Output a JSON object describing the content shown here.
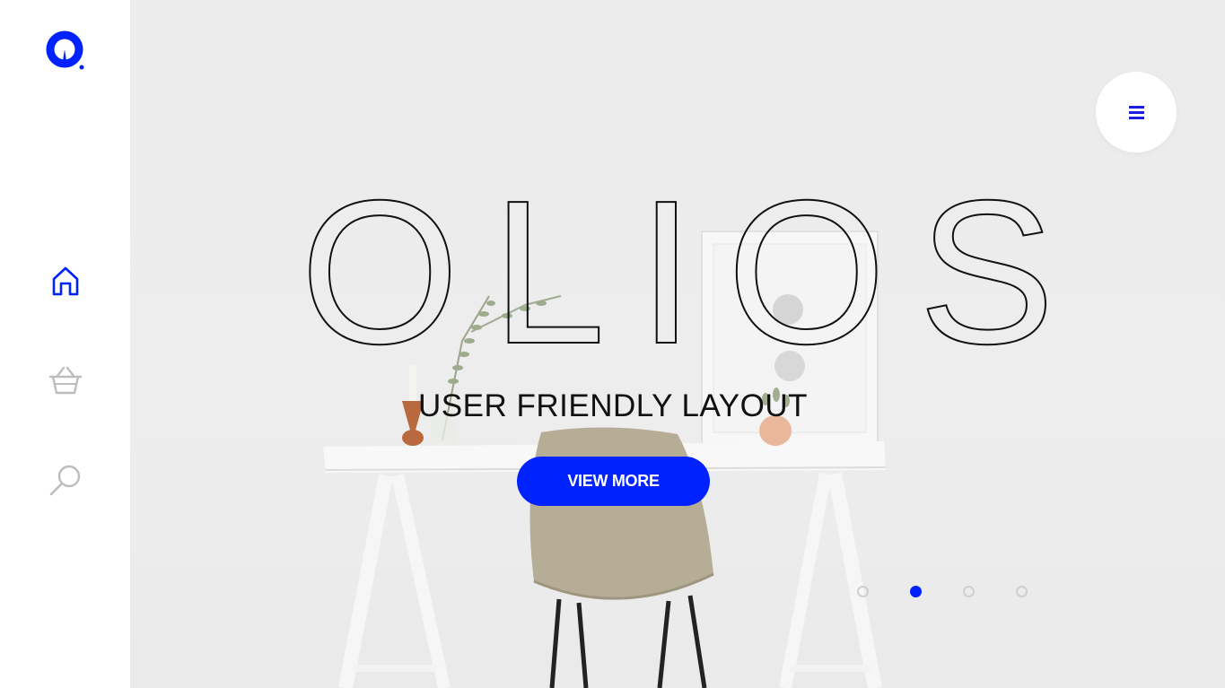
{
  "sidebar": {
    "logo_icon": "olios-logo-icon",
    "items": [
      {
        "icon": "home-icon",
        "active": true
      },
      {
        "icon": "basket-icon",
        "active": false
      },
      {
        "icon": "search-icon",
        "active": false
      }
    ]
  },
  "hero": {
    "title": "OLIOS",
    "subtitle": "USER FRIENDLY LAYOUT",
    "cta_label": "VIEW MORE",
    "menu_icon": "hamburger-menu-icon",
    "slides": {
      "count": 4,
      "active_index": 1
    }
  },
  "colors": {
    "accent": "#0022ff",
    "inactive_icon": "#bdbdbd",
    "background": "#ececec",
    "text": "#111111"
  }
}
